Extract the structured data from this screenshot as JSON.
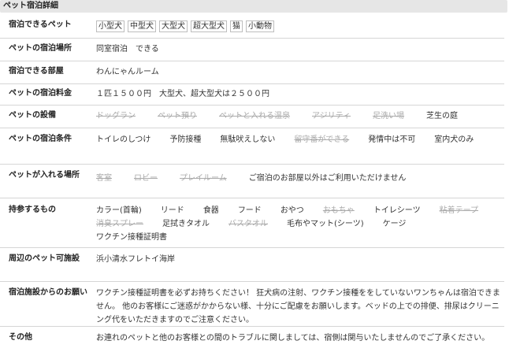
{
  "section_title": "ペット宿泊詳細",
  "rows": {
    "pets": {
      "label": "宿泊できるペット",
      "items": [
        "小型犬",
        "中型犬",
        "大型犬",
        "超大型犬",
        "猫",
        "小動物"
      ]
    },
    "location": {
      "label": "ペットの宿泊場所",
      "value": "同室宿泊　できる"
    },
    "room": {
      "label": "宿泊できる部屋",
      "value": "わんにゃんルーム"
    },
    "fee": {
      "label": "ペットの宿泊料金",
      "value": "１匹１５００円　大型犬、超大型犬は２５００円"
    },
    "facilities": {
      "label": "ペットの設備",
      "items": [
        {
          "text": "ドッグラン",
          "available": false
        },
        {
          "text": "ペット預り",
          "available": false
        },
        {
          "text": "ペットと入れる温泉",
          "available": false
        },
        {
          "text": "アジリティ",
          "available": false
        },
        {
          "text": "足洗い場",
          "available": false
        },
        {
          "text": "芝生の庭",
          "available": true
        }
      ]
    },
    "conditions": {
      "label": "ペットの宿泊条件",
      "items": [
        {
          "text": "トイレのしつけ",
          "available": true
        },
        {
          "text": "予防接種",
          "available": true
        },
        {
          "text": "無駄吠えしない",
          "available": true
        },
        {
          "text": "留守番ができる",
          "available": false
        },
        {
          "text": "発情中は不可",
          "available": true
        },
        {
          "text": "室内犬のみ",
          "available": true
        }
      ]
    },
    "areas": {
      "label": "ペットが入れる場所",
      "items": [
        {
          "text": "客室",
          "available": false
        },
        {
          "text": "ロビー",
          "available": false
        },
        {
          "text": "プレイルーム",
          "available": false
        }
      ],
      "note": "ご宿泊のお部屋以外はご利用いただけません"
    },
    "bring": {
      "label": "持参するもの",
      "items": [
        {
          "text": "カラー(首輪)",
          "available": true
        },
        {
          "text": "リード",
          "available": true
        },
        {
          "text": "食器",
          "available": true
        },
        {
          "text": "フード",
          "available": true
        },
        {
          "text": "おやつ",
          "available": true
        },
        {
          "text": "おもちゃ",
          "available": false
        },
        {
          "text": "トイレシーツ",
          "available": true
        },
        {
          "text": "粘着テープ",
          "available": false
        },
        {
          "text": "消臭スプレー",
          "available": false
        },
        {
          "text": "足拭きタオル",
          "available": true
        },
        {
          "text": "バスタオル",
          "available": false
        },
        {
          "text": "毛布やマット(シーツ)",
          "available": true
        },
        {
          "text": "ケージ",
          "available": true
        },
        {
          "text": "ワクチン接種証明書",
          "available": true
        }
      ]
    },
    "nearby": {
      "label": "周辺のペット可施設",
      "value": "浜小清水フレトイ海岸"
    },
    "request": {
      "label": "宿泊施設からのお願い",
      "value": "ワクチン接種証明書を必ずお持ちください！ 狂犬病の注射、ワクチン接種ををしていないワンちゃんは宿泊できません。 他のお客様にご迷惑がかからない様、十分にご配慮をお願いします。ベッドの上での排便、排尿はクリーニング代をいただきますのでご注意ください。"
    },
    "other": {
      "label": "その他",
      "value": "お連れのペットと他のお客様との間のトラブルに関しましては、宿側は関与いたしませんのでご了承ください。"
    }
  }
}
